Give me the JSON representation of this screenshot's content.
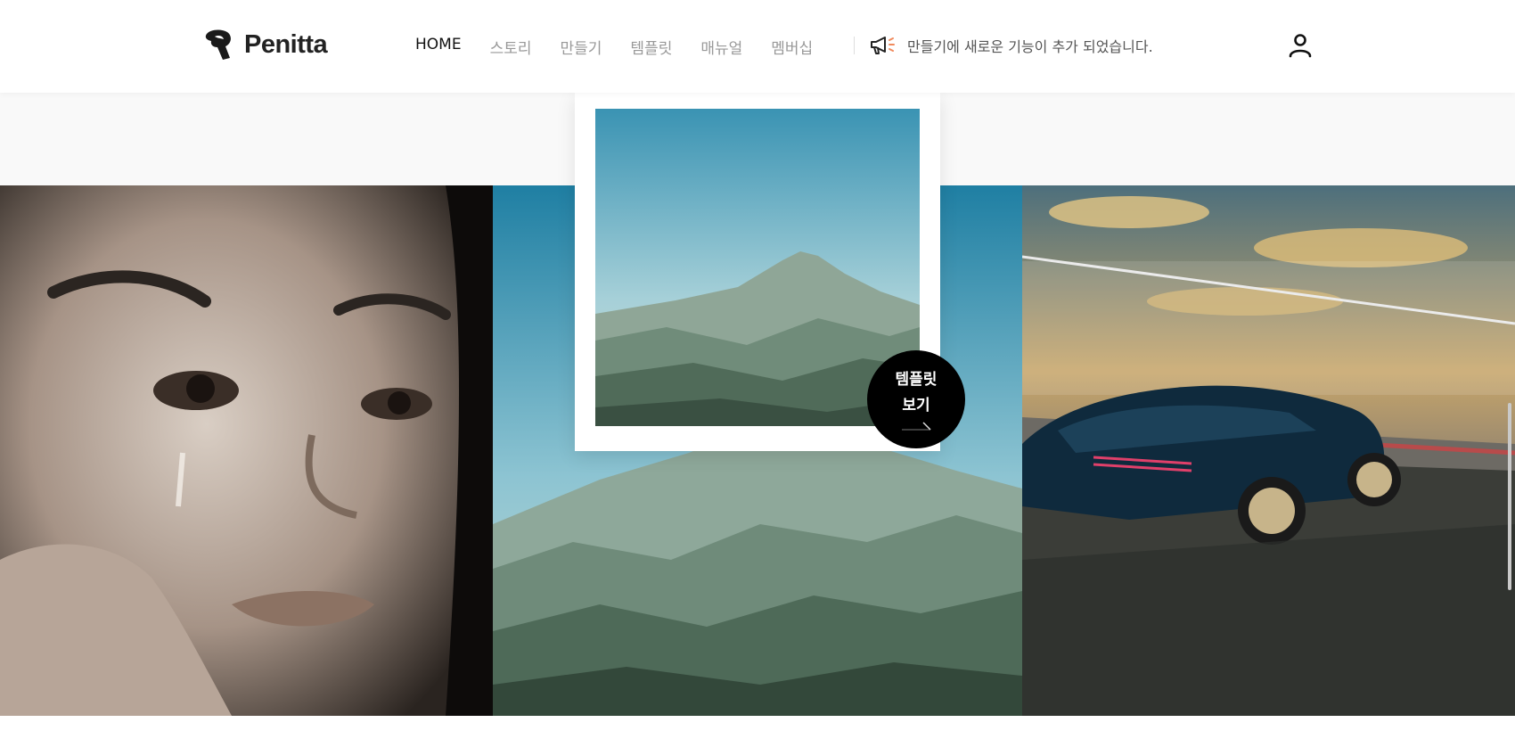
{
  "brand": {
    "name": "Penitta"
  },
  "nav": {
    "items": [
      {
        "label": "HOME",
        "active": true
      },
      {
        "label": "스토리",
        "active": false
      },
      {
        "label": "만들기",
        "active": false
      },
      {
        "label": "템플릿",
        "active": false
      },
      {
        "label": "매뉴얼",
        "active": false
      },
      {
        "label": "멤버십",
        "active": false
      }
    ]
  },
  "notice": {
    "icon": "megaphone-icon",
    "text": "만들기에 새로운 기능이 추가 되었습니다."
  },
  "user": {
    "icon": "user-icon"
  },
  "gallery": {
    "images": [
      "crying-woman-photo",
      "mountain-landscape-photo",
      "sports-car-photo"
    ]
  },
  "featured": {
    "image": "mountain-landscape-photo",
    "cta_line1": "템플릿",
    "cta_line2": "보기",
    "cta_icon": "arrow-icon"
  },
  "colors": {
    "accent": "#000000",
    "notice_icon_accent": "#f08a5d",
    "nav_inactive": "#999999"
  }
}
